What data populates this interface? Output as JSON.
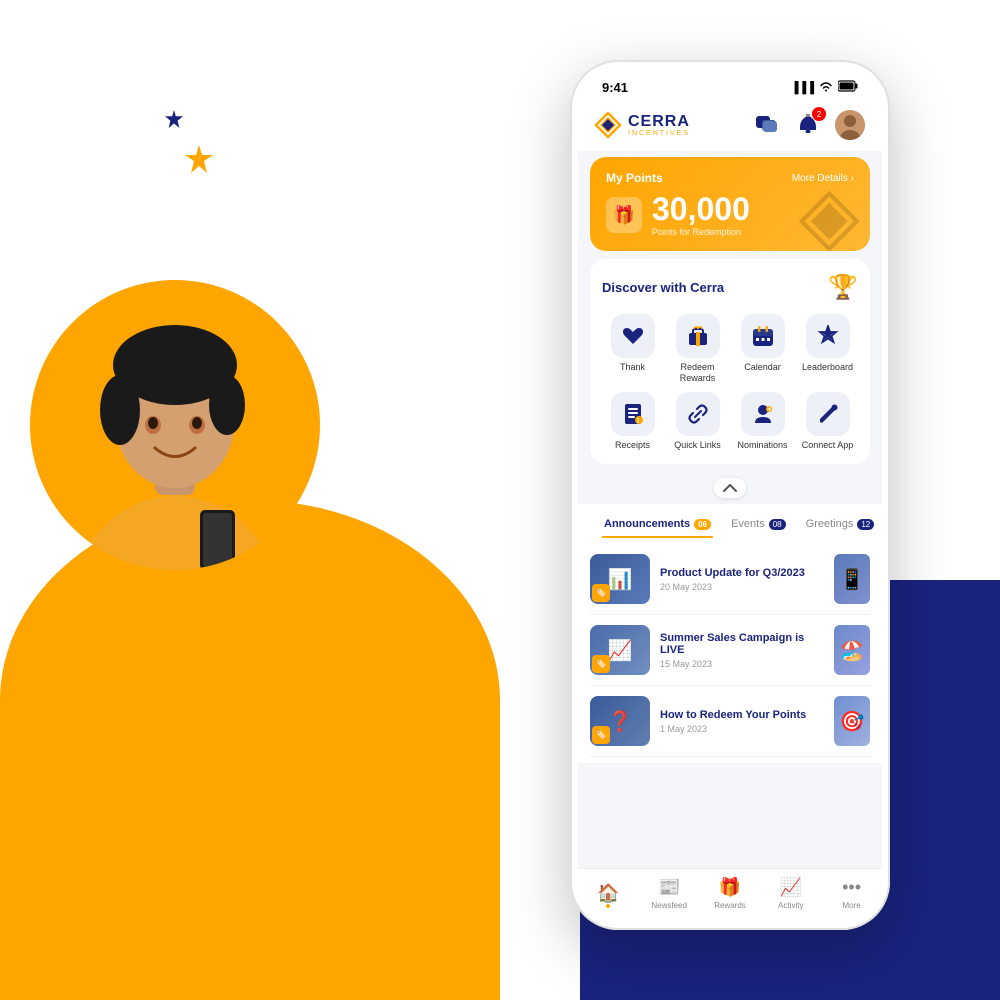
{
  "background": {
    "orange_shape": true,
    "navy_shape": true
  },
  "decorative": {
    "star_navy_color": "#1a237e",
    "star_orange_color": "#FFA500"
  },
  "status_bar": {
    "time": "9:41",
    "signal": "▐▐▐",
    "wifi": "wifi",
    "battery": "battery"
  },
  "header": {
    "logo_name": "CERRA",
    "logo_sub": "INCENTIVES",
    "chat_icon": "💬",
    "bell_icon": "🔔",
    "notif_count": "2"
  },
  "points_card": {
    "title": "My Points",
    "more_details": "More Details ›",
    "amount": "30,000",
    "sublabel": "Points for Redemption",
    "icon": "🎁"
  },
  "discover": {
    "title": "Discover with Cerra",
    "trophy_icon": "🏆",
    "items": [
      {
        "label": "Thank",
        "icon": "❤️"
      },
      {
        "label": "Redeem Rewards",
        "icon": "🎁"
      },
      {
        "label": "Calendar",
        "icon": "📅"
      },
      {
        "label": "Leaderboard",
        "icon": "👑"
      },
      {
        "label": "Receipts",
        "icon": "🧾"
      },
      {
        "label": "Quick Links",
        "icon": "🔗"
      },
      {
        "label": "Nominations",
        "icon": "👤"
      },
      {
        "label": "Connect App",
        "icon": "✏️"
      }
    ]
  },
  "tabs": [
    {
      "label": "Announcements",
      "count": "06",
      "active": true
    },
    {
      "label": "Events",
      "count": "08",
      "active": false
    },
    {
      "label": "Greetings",
      "count": "12",
      "active": false
    }
  ],
  "announcements": [
    {
      "title": "Product Update for Q3/2023",
      "date": "20 May 2023",
      "thumb_bg": "#3a5a9a",
      "thumb_emoji": "📊",
      "right_bg": "#6080c0",
      "right_emoji": "📱"
    },
    {
      "title": "Summer Sales Campaign is LIVE",
      "date": "15 May 2023",
      "thumb_bg": "#4a6aaa",
      "thumb_emoji": "📈",
      "right_bg": "#5a70b0",
      "right_emoji": "🏖️"
    },
    {
      "title": "How to Redeem Your Points",
      "date": "1 May 2023",
      "thumb_bg": "#3a5a9a",
      "thumb_emoji": "❓",
      "right_bg": "#7090d0",
      "right_emoji": "🎯"
    }
  ],
  "bottom_nav": [
    {
      "icon": "🏠",
      "label": "Home",
      "active": true
    },
    {
      "icon": "📰",
      "label": "Newsfeed",
      "active": false
    },
    {
      "icon": "🎁",
      "label": "Rewards",
      "active": false
    },
    {
      "icon": "📈",
      "label": "Activity",
      "active": false
    },
    {
      "icon": "•••",
      "label": "More",
      "active": false
    }
  ]
}
